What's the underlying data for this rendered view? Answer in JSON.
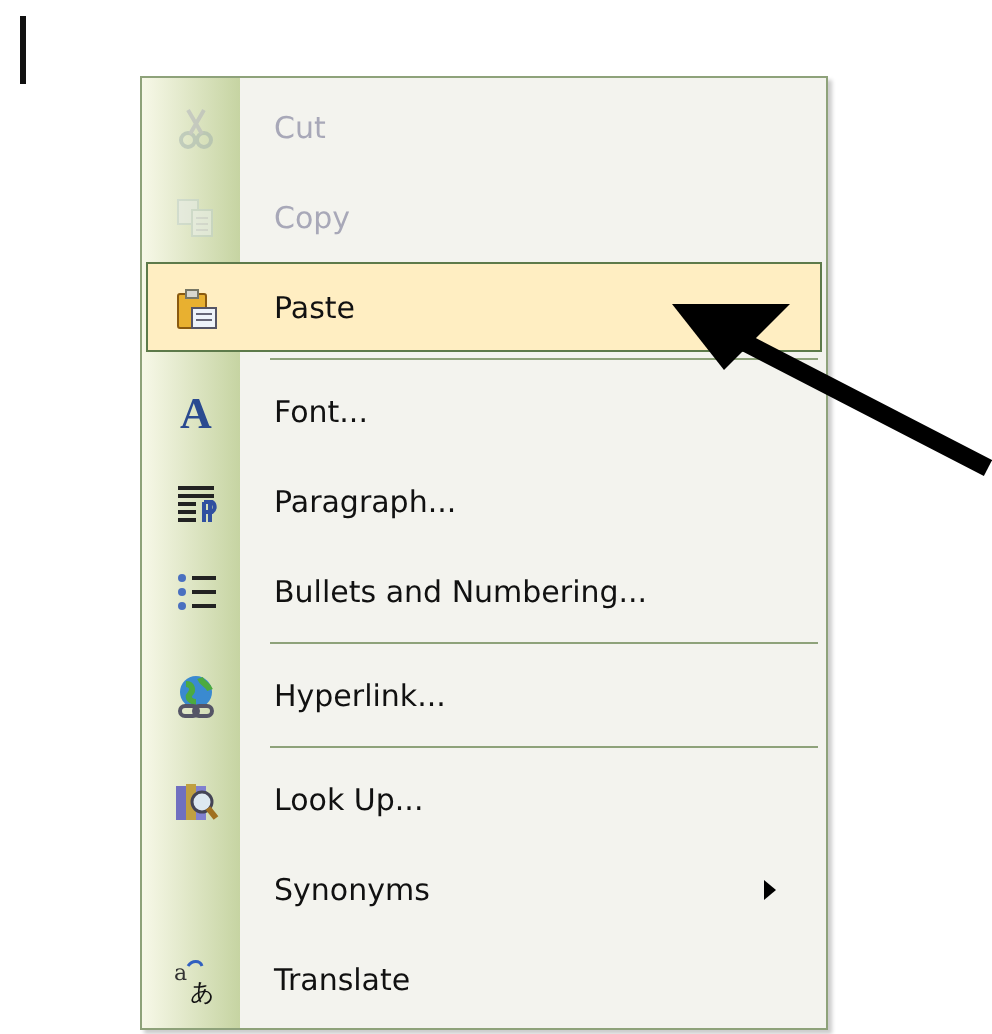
{
  "menu": {
    "items": [
      {
        "kind": "item",
        "label": "Cut",
        "disabled": true,
        "selected": false
      },
      {
        "kind": "item",
        "label": "Copy",
        "disabled": true,
        "selected": false
      },
      {
        "kind": "item",
        "label": "Paste",
        "disabled": false,
        "selected": true
      },
      {
        "kind": "separator"
      },
      {
        "kind": "item",
        "label": "Font...",
        "icon_text": [
          "A"
        ],
        "disabled": false,
        "selected": false
      },
      {
        "kind": "item",
        "label": "Paragraph...",
        "disabled": false,
        "selected": false
      },
      {
        "kind": "item",
        "label": "Bullets and Numbering...",
        "disabled": false,
        "selected": false
      },
      {
        "kind": "separator"
      },
      {
        "kind": "item",
        "label": "Hyperlink...",
        "disabled": false,
        "selected": false
      },
      {
        "kind": "separator"
      },
      {
        "kind": "item",
        "label": "Look Up...",
        "disabled": false,
        "selected": false
      },
      {
        "kind": "submenu",
        "label": "Synonyms",
        "disabled": false,
        "selected": false
      },
      {
        "kind": "item",
        "label": "Translate",
        "icon_text": [
          "a",
          "あ"
        ],
        "disabled": false,
        "selected": false
      }
    ]
  }
}
